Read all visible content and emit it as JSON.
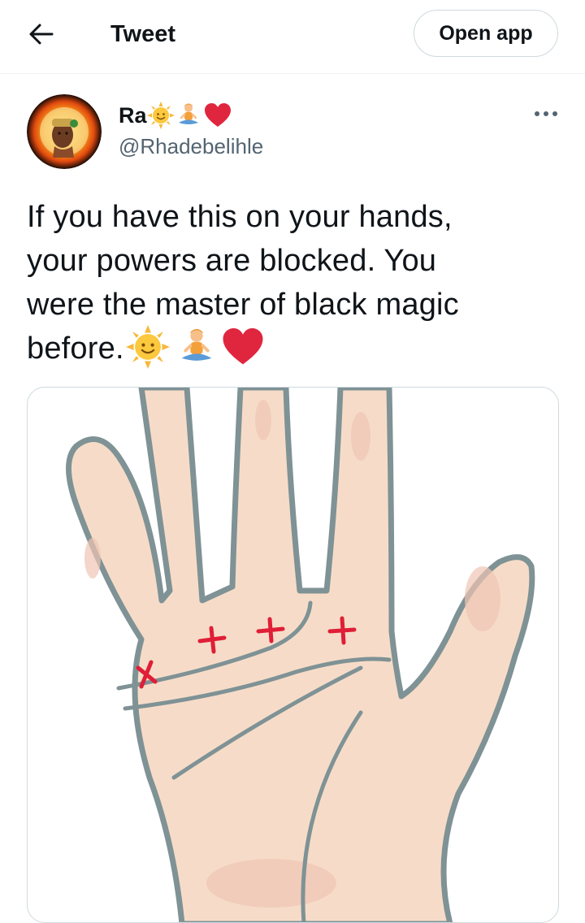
{
  "header": {
    "back_icon": "arrow-left-icon",
    "title": "Tweet",
    "open_app_label": "Open app"
  },
  "tweet": {
    "author_name": "Ra",
    "name_emojis": [
      "sun-with-face-icon",
      "person-in-lotus-position-icon",
      "red-heart-icon"
    ],
    "handle": "@Rhadebelihle",
    "more_icon": "more-options-icon",
    "text_lines": [
      "If you have this on your hands,",
      "your powers are blocked. You",
      "were the master of black magic",
      "before."
    ],
    "text_emojis": [
      "sun-with-face-icon",
      "person-in-lotus-position-icon",
      "red-heart-icon"
    ],
    "media": {
      "description_icon": "palm-illustration",
      "mark_color": "#e01e37"
    }
  },
  "colors": {
    "text": "#0f1419",
    "secondary": "#536471",
    "border": "#cfd9de",
    "heart": "#e0263f",
    "sun": "#f6b93b"
  }
}
